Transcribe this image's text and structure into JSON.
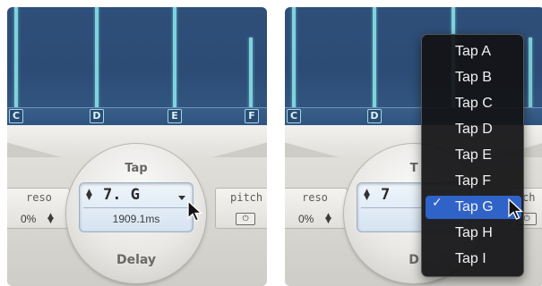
{
  "left_panel": {
    "tap_labels": [
      "C",
      "D",
      "E",
      "F"
    ],
    "knob": {
      "title": "Tap",
      "lcd_tap": "7. G",
      "lcd_ms": "1909.1ms",
      "bottom_label": "Delay"
    },
    "reso": {
      "label": "reso",
      "value": "0%"
    },
    "pitch": {
      "label": "pitch",
      "power_glyph": "⏻"
    }
  },
  "right_panel": {
    "tap_labels": [
      "C",
      "D"
    ],
    "knob": {
      "title": "T",
      "lcd_tap": "7",
      "bottom_label": "D"
    },
    "reso": {
      "label": "reso",
      "value": "0%"
    },
    "pitch": {
      "label": "ch",
      "power_glyph": "⏻"
    },
    "menu": {
      "items": [
        "Tap A",
        "Tap B",
        "Tap C",
        "Tap D",
        "Tap E",
        "Tap F",
        "Tap G",
        "Tap H",
        "Tap I"
      ],
      "selected": "Tap G",
      "check_glyph": "✓"
    }
  },
  "colors": {
    "display_bg": "#2e4f79",
    "tap_line": "#7ed3dc",
    "menu_selected": "#2f63c8"
  },
  "icons": [
    "tap-line",
    "stepper-arrows-icon",
    "dropdown-caret-icon",
    "power-icon",
    "mouse-pointer-icon",
    "checkmark-icon"
  ]
}
